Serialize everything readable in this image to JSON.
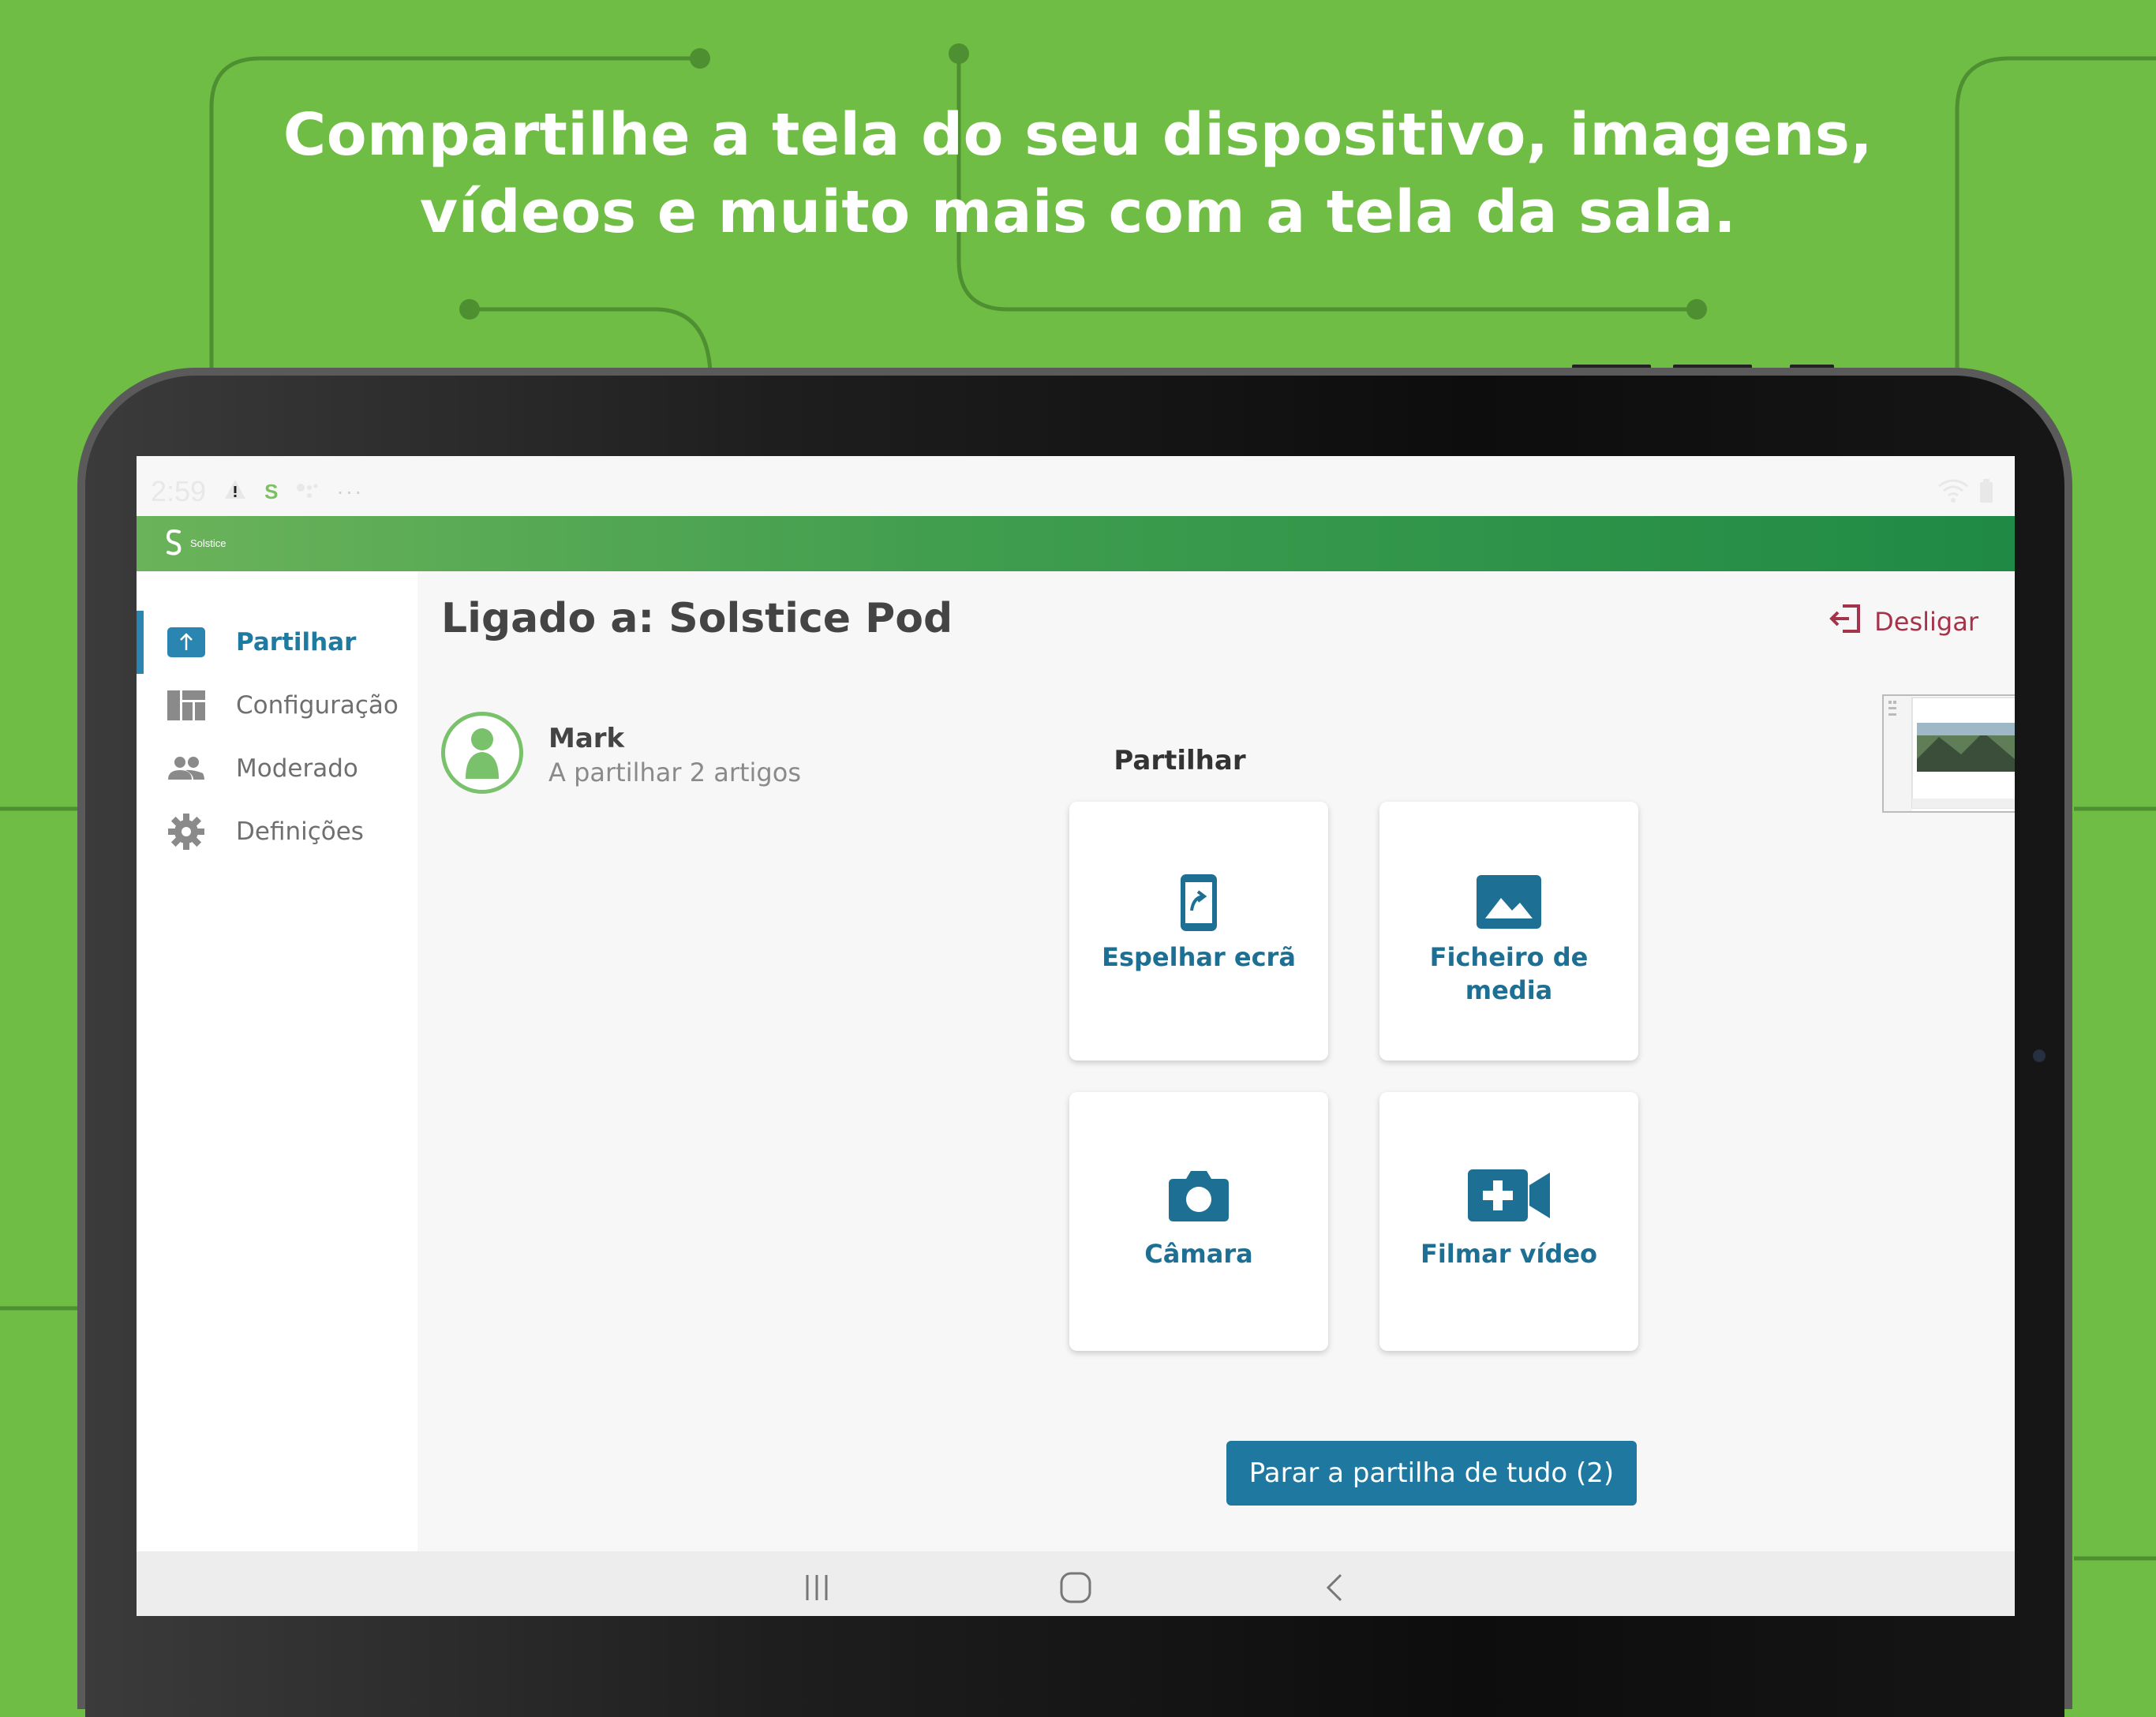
{
  "headline": {
    "line1": "Compartilhe a tela do seu dispositivo, imagens,",
    "line2": "vídeos e muito mais com a tela da sala."
  },
  "status_bar": {
    "time": "2:59",
    "icons": [
      "warning-icon",
      "solstice-icon",
      "assistant-icon",
      "more-icon",
      "wifi-icon",
      "battery-icon"
    ]
  },
  "app": {
    "logo_text": "Solstice",
    "brand_color": "#2f9a4c"
  },
  "sidebar": {
    "items": [
      {
        "label": "Partilhar",
        "icon": "share-upload-icon",
        "active": true
      },
      {
        "label": "Configuração",
        "icon": "layout-icon",
        "active": false
      },
      {
        "label": "Moderado",
        "icon": "people-icon",
        "active": false
      },
      {
        "label": "Definições",
        "icon": "gear-icon",
        "active": false
      }
    ]
  },
  "main": {
    "title": "Ligado a: Solstice Pod",
    "disconnect_label": "Desligar",
    "user": {
      "name": "Mark",
      "status": "A partilhar 2 artigos"
    },
    "share_heading": "Partilhar",
    "tiles": [
      {
        "label": "Espelhar ecrã",
        "icon": "mirror-screen-icon"
      },
      {
        "label": "Ficheiro de media",
        "icon": "image-icon"
      },
      {
        "label": "Câmara",
        "icon": "camera-icon"
      },
      {
        "label": "Filmar vídeo",
        "icon": "video-camera-icon"
      }
    ],
    "stop_button": "Parar a partilha de tudo (2)"
  },
  "colors": {
    "background": "#6fbd45",
    "accent": "#1e78a0",
    "disconnect": "#a5334a"
  }
}
